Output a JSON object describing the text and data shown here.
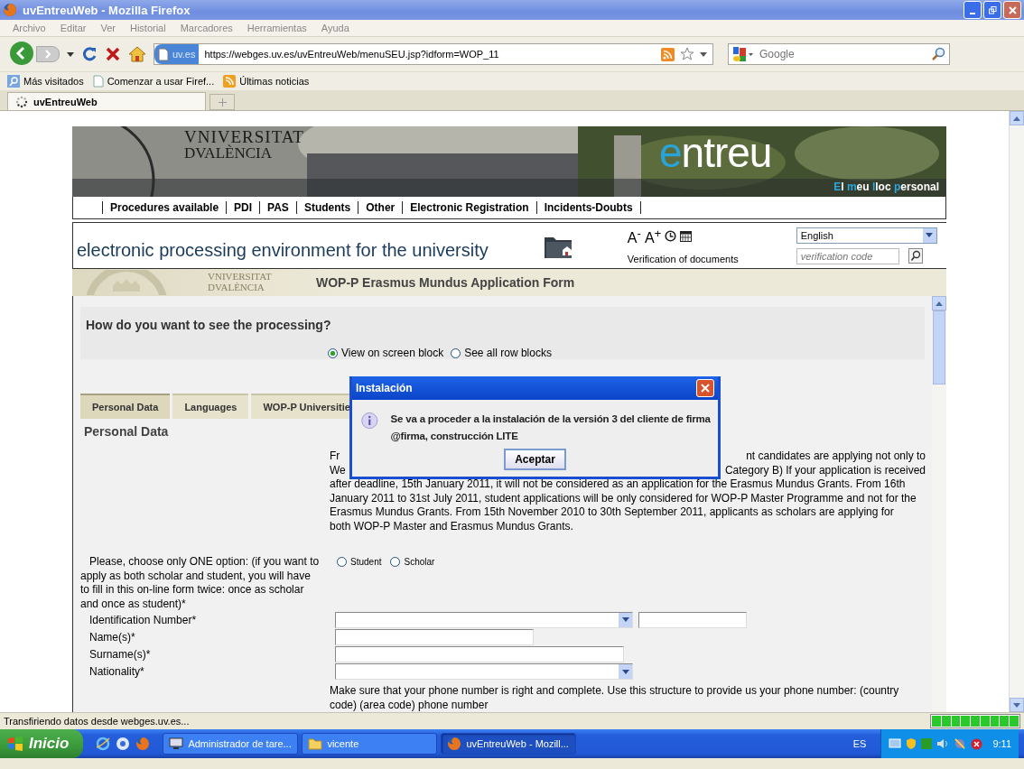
{
  "window": {
    "title": "uvEntreuWeb - Mozilla Firefox"
  },
  "menu": [
    "Archivo",
    "Editar",
    "Ver",
    "Historial",
    "Marcadores",
    "Herramientas",
    "Ayuda"
  ],
  "navbar": {
    "site_badge": "uv.es",
    "url": "https://webges.uv.es/uvEntreuWeb/menuSEU.jsp?idform=WOP_11",
    "search_placeholder": "Google"
  },
  "bookmarks": [
    "Más visitados",
    "Comenzar a usar Firef...",
    "Últimas noticias"
  ],
  "tabs": [
    {
      "label": "uvEntreuWeb",
      "selected": true
    }
  ],
  "page": {
    "logo": [
      "VNIVERSITAT",
      "DVALÈNCIA"
    ],
    "brand": "entreu",
    "tagline": [
      "El",
      "meu",
      "lloc",
      "personal"
    ],
    "nav": [
      "Procedures available",
      "PDI",
      "PAS",
      "Students",
      "Other",
      "Electronic Registration",
      "Incidents-Doubts"
    ],
    "slogan": "electronic processing environment for the university",
    "font_controls": [
      "A$^{-}$",
      "A$^{+}$"
    ],
    "verification_label": "Verification of documents",
    "language": "English",
    "verification_placeholder": "verification code",
    "small_logo": [
      "VNIVERSITAT",
      "DVALÈNCIA"
    ],
    "form_title": "WOP-P Erasmus Mundus Application Form",
    "view_question": "How do you want to see the processing?",
    "view_options": [
      {
        "label": "View on screen block",
        "selected": true
      },
      {
        "label": "See all row blocks",
        "selected": false
      }
    ],
    "form_tabs": [
      {
        "label": "Personal Data",
        "selected": true
      },
      {
        "label": "Languages",
        "selected": false
      },
      {
        "label": "WOP-P Universitie",
        "selected": false
      }
    ],
    "section_title": "Personal Data",
    "notice_fragments": [
      [
        "Fr",
        "nt candidates are applying not only to"
      ],
      [
        "We",
        "Category B) If your application is received"
      ]
    ],
    "notice_lines": [
      "after deadline, 15th January 2011, it will not be considered as an application for the Erasmus Mundus Grants. From 16th",
      "January 2011 to 31st July 2011, student applications will be only considered for WOP-P Master Programme and not for the",
      "Erasmus Mundus Grants. From 15th November 2010 to 30th September 2011, applicants as scholars are applying for",
      "both WOP-P Master and Erasmus Mundus Grants."
    ],
    "option_prompt": "Please, choose only ONE option: (if you want to apply as both scholar and student, you will have to fill in this on-line form twice: once as scholar and once as student)*",
    "role_options": [
      {
        "label": "Student",
        "selected": false
      },
      {
        "label": "Scholar",
        "selected": false
      }
    ],
    "fields": [
      {
        "label": "Identification Number*",
        "kind": "select-text"
      },
      {
        "label": "Name(s)*",
        "kind": "text"
      },
      {
        "label": "Surname(s)*",
        "kind": "wide-text"
      },
      {
        "label": "Nationality*",
        "kind": "select"
      }
    ],
    "phone_hint": "Make sure that your phone number is right and complete. Use this structure to provide us your phone number: (country code) (area code) phone number"
  },
  "dialog": {
    "title": "Instalación",
    "message": "Se va a proceder a la instalación de la versión 3 del cliente de firma @firma, construcción LITE",
    "button": "Aceptar"
  },
  "status_bar": {
    "text": "Transfiriendo datos desde webges.uv.es...",
    "level": 1
  },
  "taskbar": {
    "start": "Inicio",
    "windows": [
      {
        "label": "Administrador de tare...",
        "kind": "monitor",
        "selected": false
      },
      {
        "label": "vicente",
        "kind": "folder",
        "selected": false
      },
      {
        "label": "uvEntreuWeb - Mozill...",
        "kind": "firefox",
        "selected": true
      }
    ],
    "language": "ES",
    "clock": "9:11"
  }
}
